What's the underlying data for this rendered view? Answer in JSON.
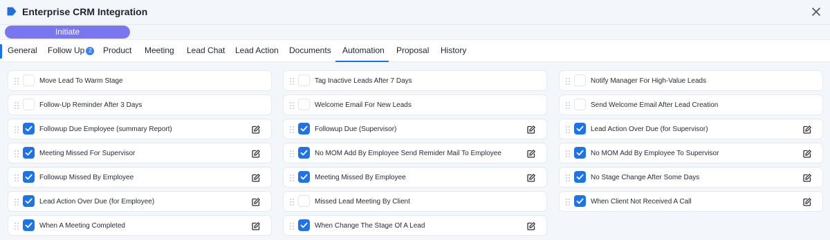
{
  "window": {
    "title": "Enterprise CRM Integration"
  },
  "stage": {
    "label": "Initiate"
  },
  "tabs": [
    {
      "label": "General"
    },
    {
      "label": "Follow Up",
      "badge": "2"
    },
    {
      "label": "Product"
    },
    {
      "label": "Meeting"
    },
    {
      "label": "Lead Chat"
    },
    {
      "label": "Lead Action"
    },
    {
      "label": "Documents"
    },
    {
      "label": "Automation",
      "active": true
    },
    {
      "label": "Proposal"
    },
    {
      "label": "History"
    }
  ],
  "automations": {
    "col1": [
      {
        "label": "Move Lead To Warm Stage",
        "checked": false,
        "editable": false
      },
      {
        "label": "Follow-Up Reminder After 3 Days",
        "checked": false,
        "editable": false
      },
      {
        "label": "Followup Due Employee (summary Report)",
        "checked": true,
        "editable": true
      },
      {
        "label": "Meeting Missed For Supervisor",
        "checked": true,
        "editable": true
      },
      {
        "label": "Followup Missed By Employee",
        "checked": true,
        "editable": true
      },
      {
        "label": "Lead Action Over Due (for Employee)",
        "checked": true,
        "editable": true
      },
      {
        "label": "When A Meeting Completed",
        "checked": true,
        "editable": true
      }
    ],
    "col2": [
      {
        "label": "Tag Inactive Leads After 7 Days",
        "checked": false,
        "editable": false
      },
      {
        "label": "Welcome Email For New Leads",
        "checked": false,
        "editable": false
      },
      {
        "label": "Followup Due (Supervisor)",
        "checked": true,
        "editable": true
      },
      {
        "label": "No MOM Add By Employee Send Remider Mail To Employee",
        "checked": true,
        "editable": true
      },
      {
        "label": "Meeting Missed By Employee",
        "checked": true,
        "editable": true
      },
      {
        "label": "Missed Lead Meeting By Client",
        "checked": false,
        "editable": false
      },
      {
        "label": "When Change The Stage Of A Lead",
        "checked": true,
        "editable": true
      }
    ],
    "col3": [
      {
        "label": "Notify Manager For High-Value Leads",
        "checked": false,
        "editable": false
      },
      {
        "label": "Send Welcome Email After Lead Creation",
        "checked": false,
        "editable": false
      },
      {
        "label": "Lead Action Over Due (for Supervisor)",
        "checked": true,
        "editable": true
      },
      {
        "label": "No MOM Add By Employee To Supervisor",
        "checked": true,
        "editable": true
      },
      {
        "label": "No Stage Change After Some Days",
        "checked": true,
        "editable": true
      },
      {
        "label": "When Client Not Received A Call",
        "checked": true,
        "editable": true
      }
    ]
  },
  "icons": {
    "title": "tag-icon",
    "close": "close-icon",
    "drag": "drag-handle-icon",
    "check": "check-icon",
    "edit": "edit-icon"
  },
  "colors": {
    "accent": "#1d6fe3",
    "stage_pill": "#7a76f0",
    "checkbox_checked": "#1f73e8",
    "badge": "#3b82f6"
  }
}
